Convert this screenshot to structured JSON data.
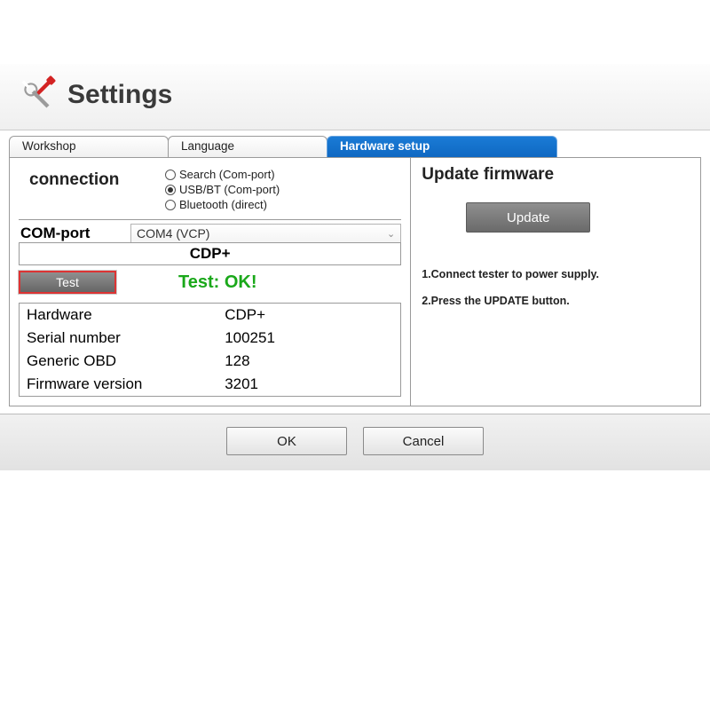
{
  "header": {
    "title": "Settings"
  },
  "tabs": {
    "workshop": "Workshop",
    "language": "Language",
    "hardware": "Hardware setup"
  },
  "left": {
    "connection_label": "connection",
    "radio_search": "Search (Com-port)",
    "radio_usbbt": "USB/BT (Com-port)",
    "radio_bluetooth": "Bluetooth (direct)",
    "comport_label": "COM-port",
    "comport_value": "COM4 (VCP)",
    "cdp_label": "CDP+",
    "test_button": "Test",
    "test_result": "Test: OK!",
    "info": {
      "hardware_l": "Hardware",
      "hardware_v": "CDP+",
      "serial_l": "Serial number",
      "serial_v": "100251",
      "obd_l": "Generic OBD",
      "obd_v": "128",
      "fw_l": "Firmware version",
      "fw_v": "3201"
    }
  },
  "right": {
    "title": "Update firmware",
    "update_button": "Update",
    "line1": "1.Connect tester to power supply.",
    "line2": "2.Press the UPDATE button."
  },
  "footer": {
    "ok": "OK",
    "cancel": "Cancel"
  }
}
